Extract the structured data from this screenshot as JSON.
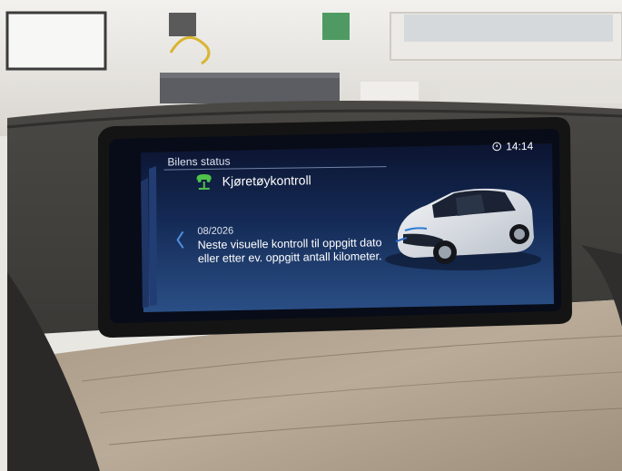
{
  "screen": {
    "section_title": "Bilens status",
    "clock": "14:14",
    "heading": "Kjøretøykontroll",
    "date": "08/2026",
    "message": "Neste visuelle kontroll til oppgitt dato eller etter ev. oppgitt antall kilometer."
  },
  "colors": {
    "screen_bg": "#13213d",
    "accent_green": "#4ec24a",
    "chevron_blue": "#4f8fe0"
  },
  "icons": {
    "heading": "vehicle-lift-icon",
    "clock": "compass-icon",
    "back": "chevron-left-icon"
  }
}
